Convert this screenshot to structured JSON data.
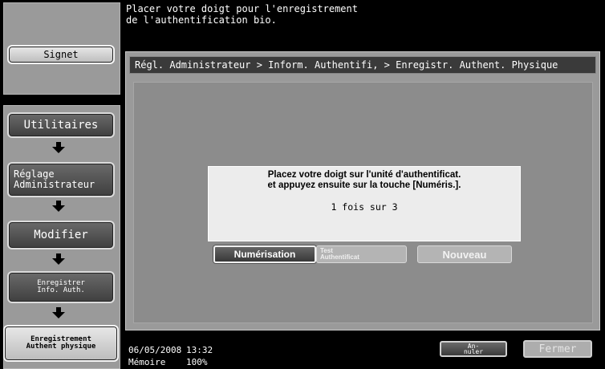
{
  "top_message": "Placer votre doigt pour l'enregistrement\nde l'authentification bio.",
  "sidebar": {
    "signet_label": "Signet",
    "flow": [
      {
        "label": "Utilitaires"
      },
      {
        "label": "Réglage\nAdministrateur"
      },
      {
        "label": "Modifier"
      },
      {
        "label": "Enregistrer\nInfo. Auth."
      },
      {
        "label": "Enregistrement\nAuthent physique"
      }
    ]
  },
  "breadcrumb": "Régl. Administrateur > Inform. Authentifi, > Enregistr. Authent. Physique",
  "dialog": {
    "line1": "Placez votre doigt sur l'unité d'authentificat.",
    "line2": "et appuyez ensuite sur la touche [Numéris.].",
    "count": "1 fois sur 3"
  },
  "buttons": {
    "numerisation": "Numérisation",
    "test": "Test\nAuthentificat",
    "nouveau": "Nouveau",
    "annuler": "An-\nnuler",
    "fermer": "Fermer"
  },
  "footer": {
    "date": "06/05/2008",
    "time": "13:32",
    "memory_label": "Mémoire",
    "memory_value": "100%"
  }
}
